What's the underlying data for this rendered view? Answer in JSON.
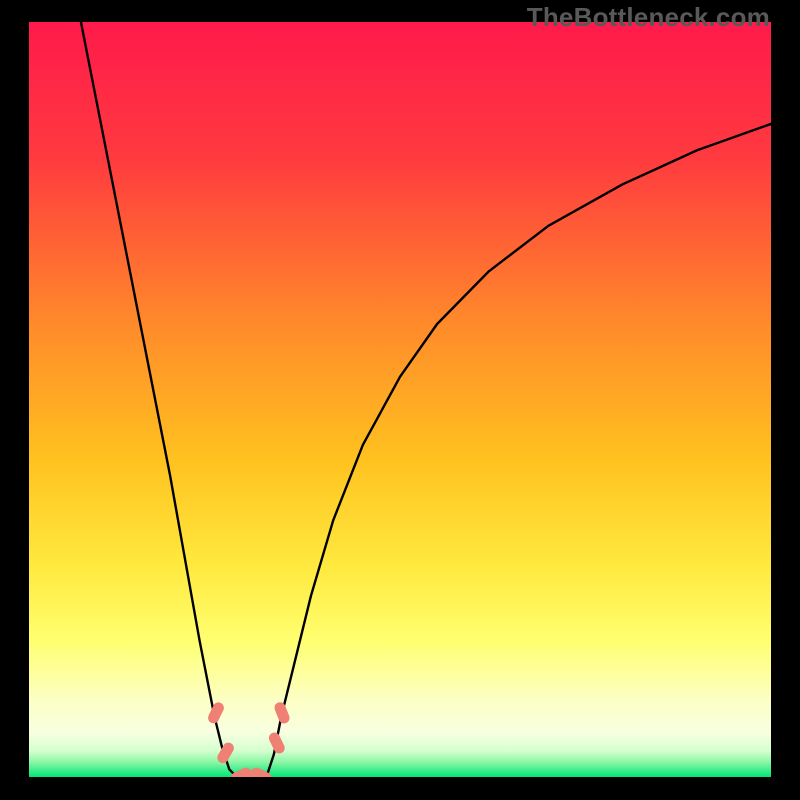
{
  "watermark": "TheBottleneck.com",
  "colors": {
    "bg": "#000000",
    "grad_top": "#ff1a4b",
    "grad_mid1": "#ff7a2e",
    "grad_mid2": "#ffd527",
    "grad_mid3": "#ffff66",
    "grad_mid4": "#f8ffb8",
    "grad_bottom": "#00e676",
    "curve": "#000000",
    "marker_fill": "#f08074",
    "marker_stroke": "#b24438",
    "watermark": "#595959"
  },
  "chart_data": {
    "type": "line",
    "title": "",
    "xlabel": "",
    "ylabel": "",
    "xlim": [
      0,
      100
    ],
    "ylim": [
      0,
      100
    ],
    "series": [
      {
        "name": "left-branch",
        "x": [
          7,
          9,
          11,
          13,
          15,
          17,
          19,
          21,
          23,
          25,
          26,
          27,
          28
        ],
        "y": [
          100,
          90,
          80,
          70,
          60,
          50,
          40,
          29,
          18,
          8,
          4,
          1,
          0
        ]
      },
      {
        "name": "right-branch",
        "x": [
          32,
          33,
          34,
          36,
          38,
          41,
          45,
          50,
          55,
          62,
          70,
          80,
          90,
          100
        ],
        "y": [
          0,
          3,
          8,
          16,
          24,
          34,
          44,
          53,
          60,
          67,
          73,
          78.5,
          83,
          86.5
        ]
      }
    ],
    "valley_floor_x": [
      28,
      32
    ],
    "markers": [
      {
        "x": 25.2,
        "y": 8.5,
        "angle": -64
      },
      {
        "x": 26.5,
        "y": 3.2,
        "angle": -60
      },
      {
        "x": 28.6,
        "y": 0.2,
        "angle": -25
      },
      {
        "x": 30.0,
        "y": 0.0,
        "angle": 0
      },
      {
        "x": 31.3,
        "y": 0.2,
        "angle": 25
      },
      {
        "x": 33.4,
        "y": 4.5,
        "angle": 64
      },
      {
        "x": 34.1,
        "y": 8.5,
        "angle": 68
      }
    ]
  },
  "annotations": {
    "marker_shape_note": "rounded-capsule"
  }
}
